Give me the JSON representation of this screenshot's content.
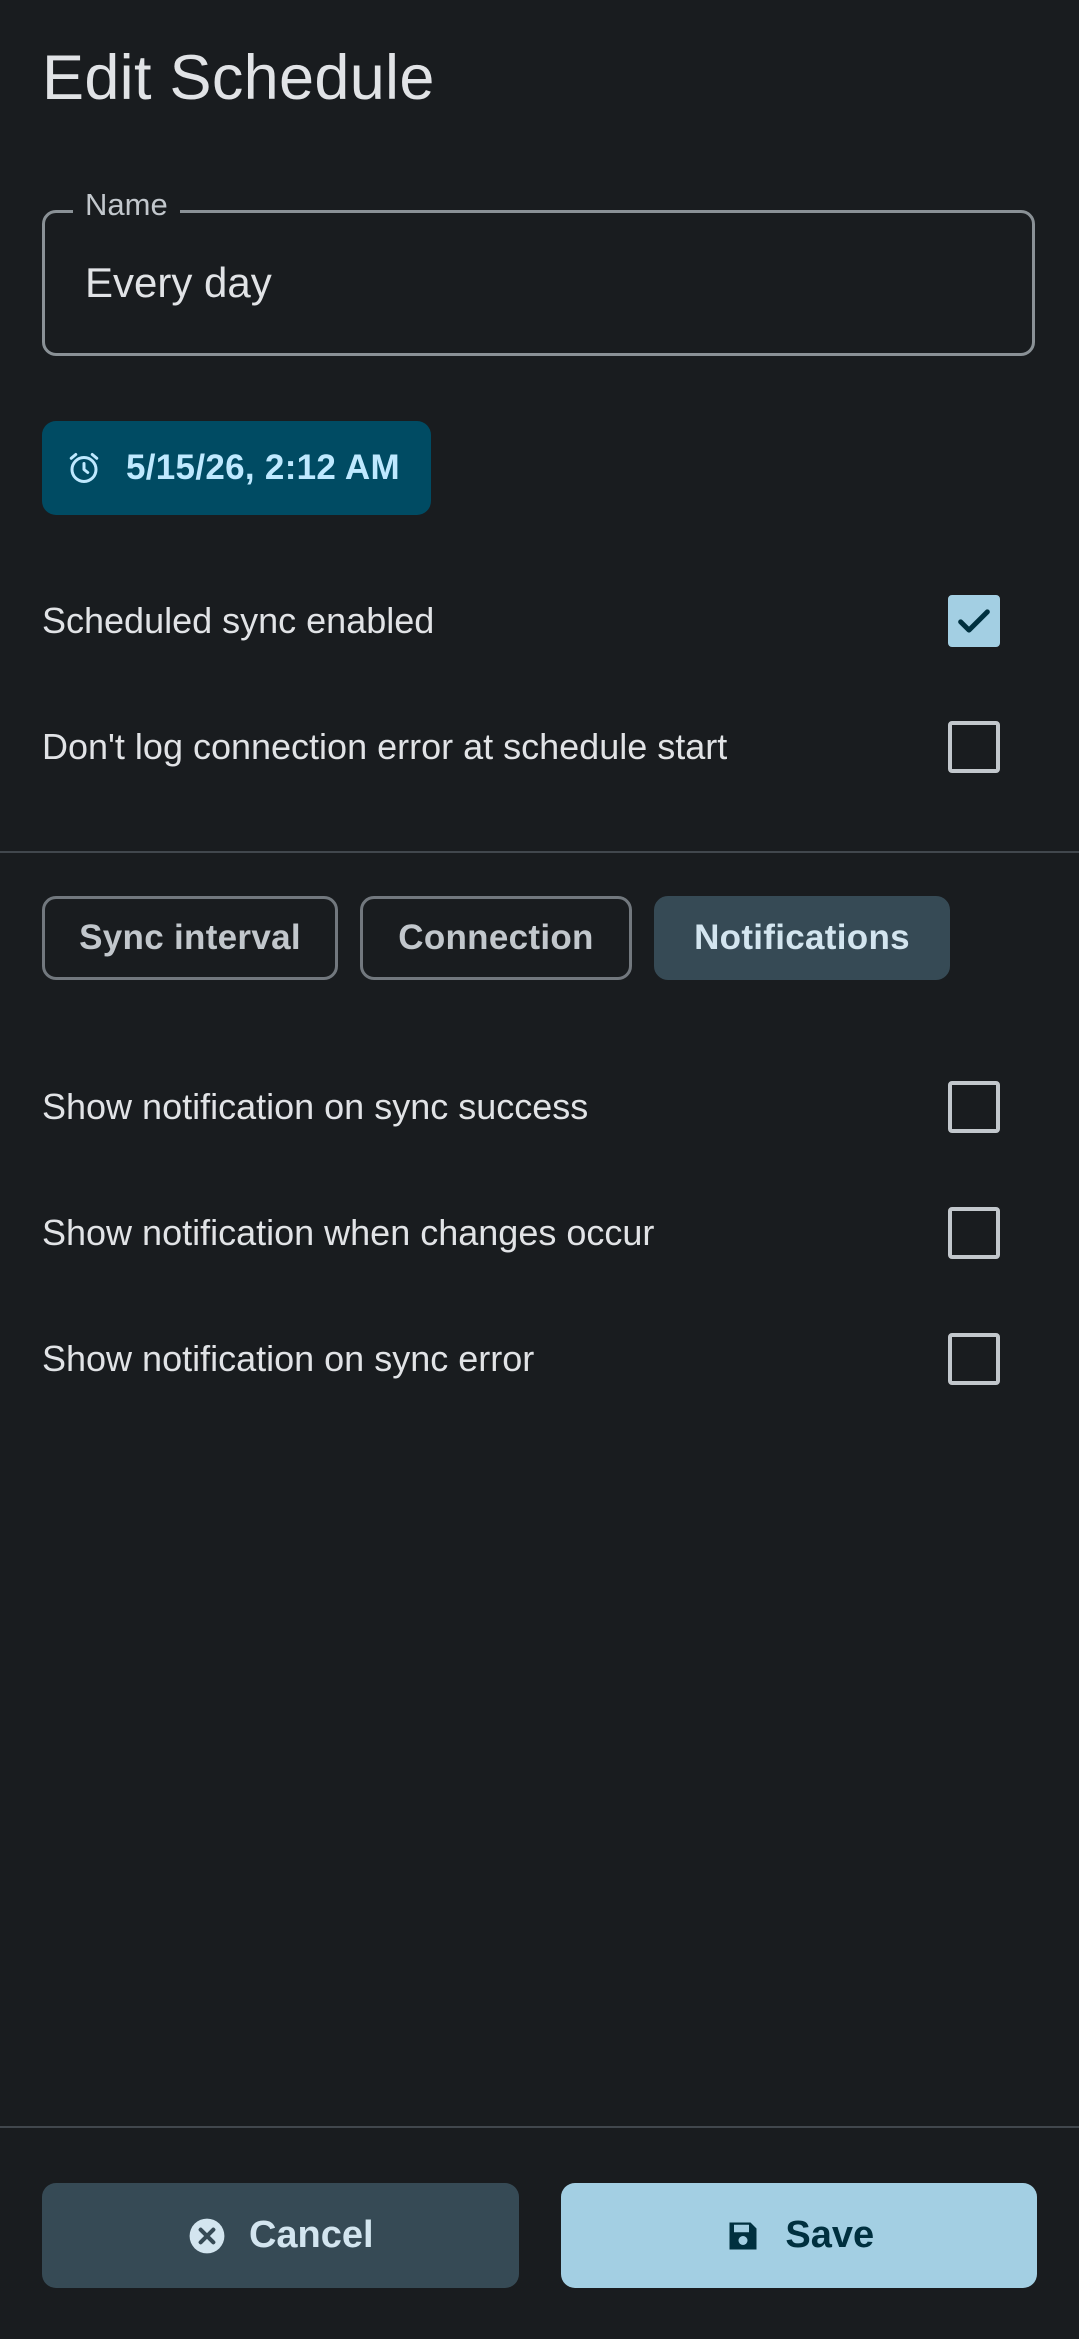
{
  "dialog": {
    "title": "Edit Schedule"
  },
  "name_field": {
    "label": "Name",
    "value": "Every day"
  },
  "datetime_chip": {
    "icon": "alarm-icon",
    "text": "5/15/26, 2:12 AM"
  },
  "options": [
    {
      "label": "Scheduled sync enabled",
      "checked": true
    },
    {
      "label": "Don't log connection error at schedule start",
      "checked": false
    }
  ],
  "tabs": [
    {
      "label": "Sync interval",
      "selected": false
    },
    {
      "label": "Connection",
      "selected": false
    },
    {
      "label": "Notifications",
      "selected": true
    }
  ],
  "notifications": [
    {
      "label": "Show notification on sync success",
      "checked": false
    },
    {
      "label": "Show notification when changes occur",
      "checked": false
    },
    {
      "label": "Show notification on sync error",
      "checked": false
    }
  ],
  "actions": {
    "cancel_label": "Cancel",
    "cancel_icon": "cancel-circle-icon",
    "save_label": "Save",
    "save_icon": "save-disk-icon"
  },
  "colors": {
    "background": "#191c1f",
    "chip": "#004b63",
    "selected_tab": "#364a55",
    "save_button": "#a3cfe3",
    "checkbox_checked": "#a3cfe3"
  }
}
